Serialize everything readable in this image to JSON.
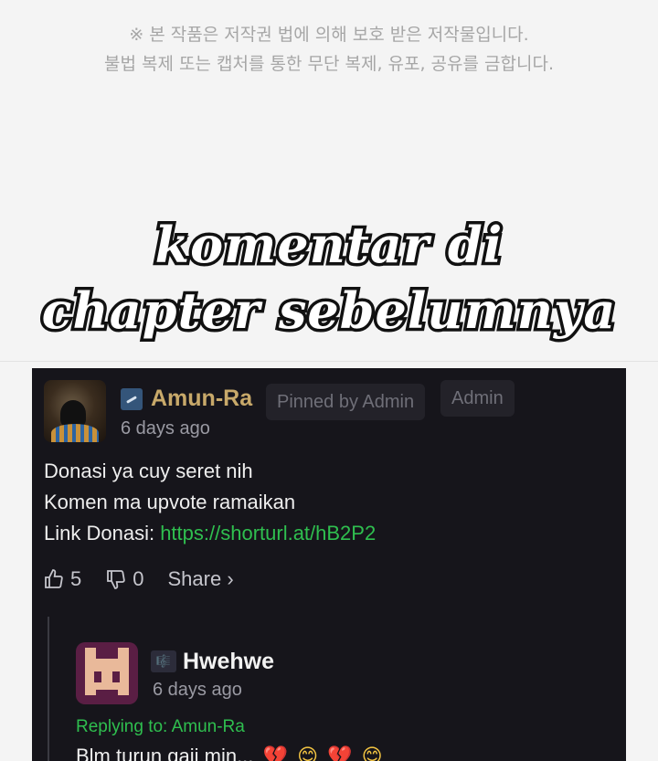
{
  "notice": {
    "line1": "※ 본 작품은 저작권 법에 의해 보호 받은 저작물입니다.",
    "line2": "불법 복제 또는 캡처를 통한 무단 복제, 유포, 공유를 금합니다."
  },
  "headline": {
    "line1": "komentar di",
    "line2": "chapter sebelumnya"
  },
  "comment": {
    "author": "Amun-Ra",
    "pinned_label": "Pinned by Admin",
    "role_label": "Admin",
    "time": "6 days ago",
    "lines": [
      "Donasi ya cuy seret nih",
      "Komen ma upvote ramaikan"
    ],
    "link_prefix": "Link Donasi: ",
    "link_url": "https://shorturl.at/hB2P2",
    "upvotes": "5",
    "downvotes": "0",
    "share_label": "Share ›"
  },
  "reply": {
    "badge": "🎼",
    "author": "Hwehwe",
    "time": "6 days ago",
    "replying_to": "Replying to: Amun-Ra",
    "text": "Blm turun gaji min...",
    "emojis": [
      "💔",
      "😊",
      "💔",
      "😊"
    ]
  },
  "colors": {
    "author_gold": "#c8a96a",
    "link_green": "#2fbf4f",
    "panel_bg": "#16151b"
  }
}
